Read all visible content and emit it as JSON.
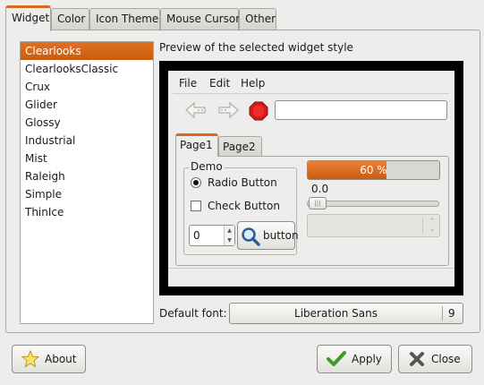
{
  "tabs": [
    {
      "label": "Widget",
      "active": true
    },
    {
      "label": "Color"
    },
    {
      "label": "Icon Theme"
    },
    {
      "label": "Mouse Cursor"
    },
    {
      "label": "Other"
    }
  ],
  "themes": {
    "selected": "Clearlooks",
    "items": [
      "Clearlooks",
      "ClearlooksClassic",
      "Crux",
      "Glider",
      "Glossy",
      "Industrial",
      "Mist",
      "Raleigh",
      "Simple",
      "ThinIce"
    ]
  },
  "preview": {
    "heading": "Preview of the selected widget style",
    "menu": [
      "File",
      "Edit",
      "Help"
    ],
    "toolbar_icons": [
      "back-arrow-icon",
      "forward-arrow-icon",
      "stop-icon"
    ],
    "entry_value": "",
    "tabs": [
      "Page1",
      "Page2"
    ],
    "frame_label": "Demo",
    "radio_label": "Radio Button",
    "check_label": "Check Button",
    "spin_value": "0",
    "button_label": "button",
    "progress_text": "60 %",
    "progress_fraction": 0.6,
    "scale_value": "0.0",
    "combo_value": ""
  },
  "font": {
    "label": "Default font:",
    "family": "Liberation Sans",
    "size": "9"
  },
  "buttons": {
    "about": "About",
    "apply": "Apply",
    "close": "Close"
  },
  "colors": {
    "accent": "#d9681f",
    "selection": "#c85d12"
  }
}
